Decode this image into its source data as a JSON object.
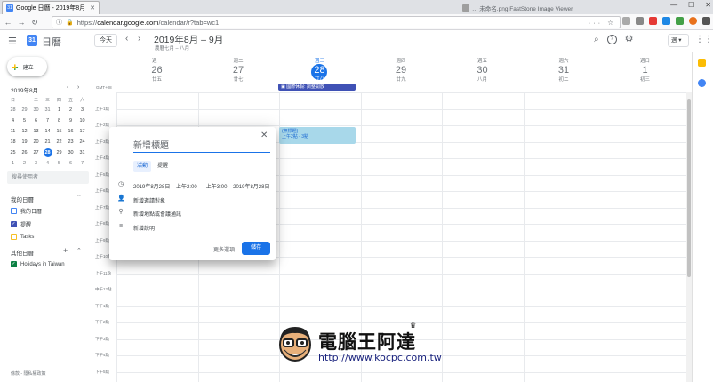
{
  "browser": {
    "tab_title": "Google 日曆 - 2019年8月",
    "inactive_tab_title": "… 未命名.png    FastStone Image Viewer",
    "url_prefix": "https://",
    "url_domain": "calendar.google.com",
    "url_path": "/calendar/r?tab=wc1",
    "window_controls": [
      "—",
      "☐",
      "✕"
    ]
  },
  "header": {
    "app_title": "日曆",
    "logo_day": "31",
    "today_button": "今天",
    "date_range": "2019年8月 – 9月",
    "lunar_range": "農曆七月 – 八月",
    "view_select": "週 ▾"
  },
  "sidebar": {
    "create_label": "建立",
    "mini_month": "2019年8月",
    "mini_weekdays": [
      "日",
      "一",
      "二",
      "三",
      "四",
      "五",
      "六"
    ],
    "mini_weeks": [
      [
        "28",
        "29",
        "30",
        "31",
        "1",
        "2",
        "3"
      ],
      [
        "4",
        "5",
        "6",
        "7",
        "8",
        "9",
        "10"
      ],
      [
        "11",
        "12",
        "13",
        "14",
        "15",
        "16",
        "17"
      ],
      [
        "18",
        "19",
        "20",
        "21",
        "22",
        "23",
        "24"
      ],
      [
        "25",
        "26",
        "27",
        "28",
        "29",
        "30",
        "31"
      ],
      [
        "1",
        "2",
        "3",
        "4",
        "5",
        "6",
        "7"
      ]
    ],
    "selected_day": "28",
    "search_people_placeholder": "搜尋使用者",
    "my_calendars_title": "我的日曆",
    "my_calendars": [
      {
        "label": "我的日曆",
        "color": "#4285f4",
        "checked": false
      },
      {
        "label": "提醒",
        "color": "#3f51b5",
        "checked": true
      },
      {
        "label": "Tasks",
        "color": "#f6bf26",
        "checked": false
      }
    ],
    "other_calendars_title": "其他日曆",
    "other_calendars": [
      {
        "label": "Holidays in Taiwan",
        "color": "#0b8043",
        "checked": true
      }
    ],
    "footer": "條款 - 隱私權政策"
  },
  "week": {
    "gmt_label": "GMT+08",
    "days": [
      {
        "weekday": "週一",
        "date": "26",
        "lunar": "廿五"
      },
      {
        "weekday": "週二",
        "date": "27",
        "lunar": "廿七"
      },
      {
        "weekday": "週三",
        "date": "28",
        "lunar": "廿八",
        "today": true
      },
      {
        "weekday": "週四",
        "date": "29",
        "lunar": "廿九"
      },
      {
        "weekday": "週五",
        "date": "30",
        "lunar": "八月"
      },
      {
        "weekday": "週六",
        "date": "31",
        "lunar": "初二"
      },
      {
        "weekday": "週日",
        "date": "1",
        "lunar": "初三"
      }
    ],
    "time_labels": [
      "上午1點",
      "上午2點",
      "上午3點",
      "上午4點",
      "上午5點",
      "上午6點",
      "上午7點",
      "上午8點",
      "上午9點",
      "上午10點",
      "上午11點",
      "中午12點",
      "下午1點",
      "下午2點",
      "下午3點",
      "下午4點",
      "下午5點"
    ],
    "allday_event": "國際休假: 調整開放",
    "timed_event_title": "(無標題)",
    "timed_event_time": "上午2點 - 3點"
  },
  "dialog": {
    "title_placeholder": "新增標題",
    "tab_event": "活動",
    "tab_reminder": "提醒",
    "start_date": "2019年8月28日",
    "start_time": "上午2:00",
    "dash": "–",
    "end_time": "上午3:00",
    "end_date": "2019年8月28日",
    "add_guests": "新增邀請對象",
    "add_location": "新增地點或會議通訊",
    "add_description": "新增說明",
    "more_options": "更多選項",
    "save": "儲存",
    "close": "✕"
  },
  "watermark": {
    "name": "電腦王阿達",
    "url": "http://www.kocpc.com.tw"
  }
}
